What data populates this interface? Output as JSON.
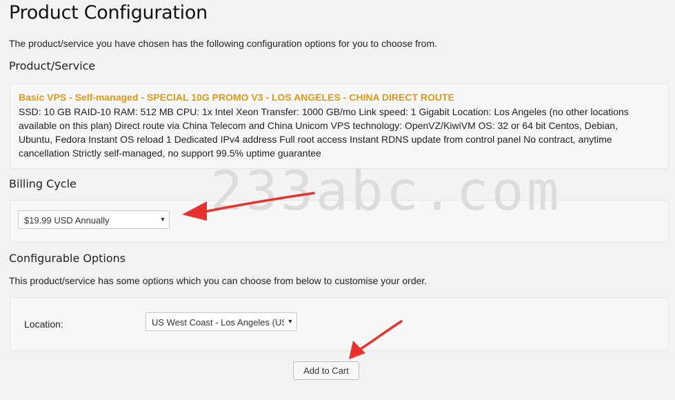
{
  "page": {
    "title": "Product Configuration",
    "intro": "The product/service you have chosen has the following configuration options for you to choose from."
  },
  "product_section": {
    "title": "Product/Service",
    "name": "Basic VPS - Self-managed - SPECIAL 10G PROMO V3 - LOS ANGELES - CHINA DIRECT ROUTE",
    "description": "SSD: 10 GB RAID-10 RAM: 512 MB CPU: 1x Intel Xeon Transfer: 1000 GB/mo Link speed: 1 Gigabit Location: Los Angeles (no other locations available on this plan) Direct route via China Telecom and China Unicom VPS technology: OpenVZ/KiwiVM OS: 32 or 64 bit Centos, Debian, Ubuntu, Fedora Instant OS reload 1 Dedicated IPv4 address Full root access Instant RDNS update from control panel No contract, anytime cancellation Strictly self-managed, no support 99.5% uptime guarantee"
  },
  "billing_section": {
    "title": "Billing Cycle",
    "selected": "$19.99 USD Annually"
  },
  "options_section": {
    "title": "Configurable Options",
    "intro": "This product/service has some options which you can choose from below to customise your order.",
    "location_label": "Location:",
    "location_selected": "US West Coast - Los Angeles (USA)"
  },
  "actions": {
    "add_to_cart": "Add to Cart"
  },
  "watermark": "233abc.com",
  "colors": {
    "product_name": "#dc9a14",
    "annotation_arrow": "#e8322d"
  },
  "icons": {
    "dropdown": "caret-down-icon",
    "annotation": "arrow-pointer-icon"
  }
}
